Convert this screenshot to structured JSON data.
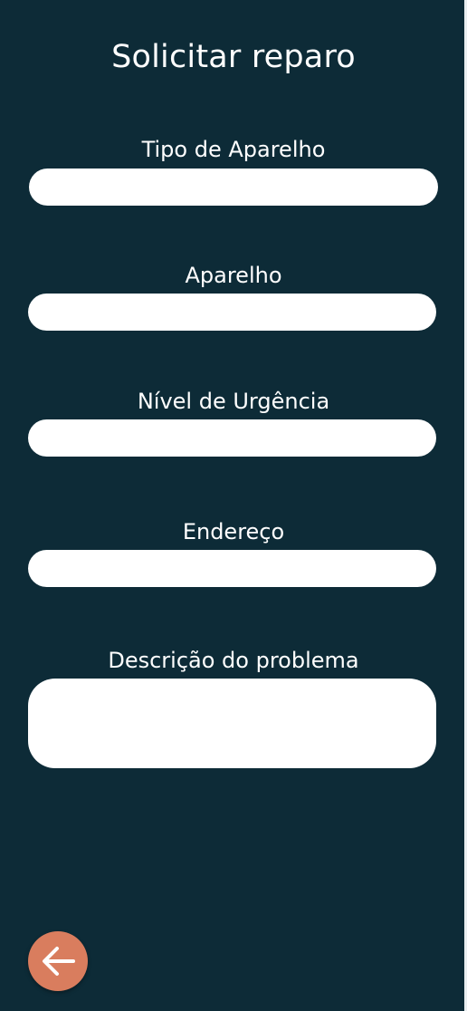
{
  "page": {
    "title": "Solicitar reparo"
  },
  "form": {
    "fields": [
      {
        "label": "Tipo de Aparelho",
        "value": ""
      },
      {
        "label": "Aparelho",
        "value": ""
      },
      {
        "label": "Nível de Urgência",
        "value": ""
      },
      {
        "label": "Endereço",
        "value": ""
      },
      {
        "label": "Descrição do problema",
        "value": ""
      }
    ]
  },
  "colors": {
    "background": "#0d2b37",
    "field": "#ffffff",
    "accent": "#d97d5e"
  },
  "icons": {
    "back": "arrow-left-icon"
  }
}
